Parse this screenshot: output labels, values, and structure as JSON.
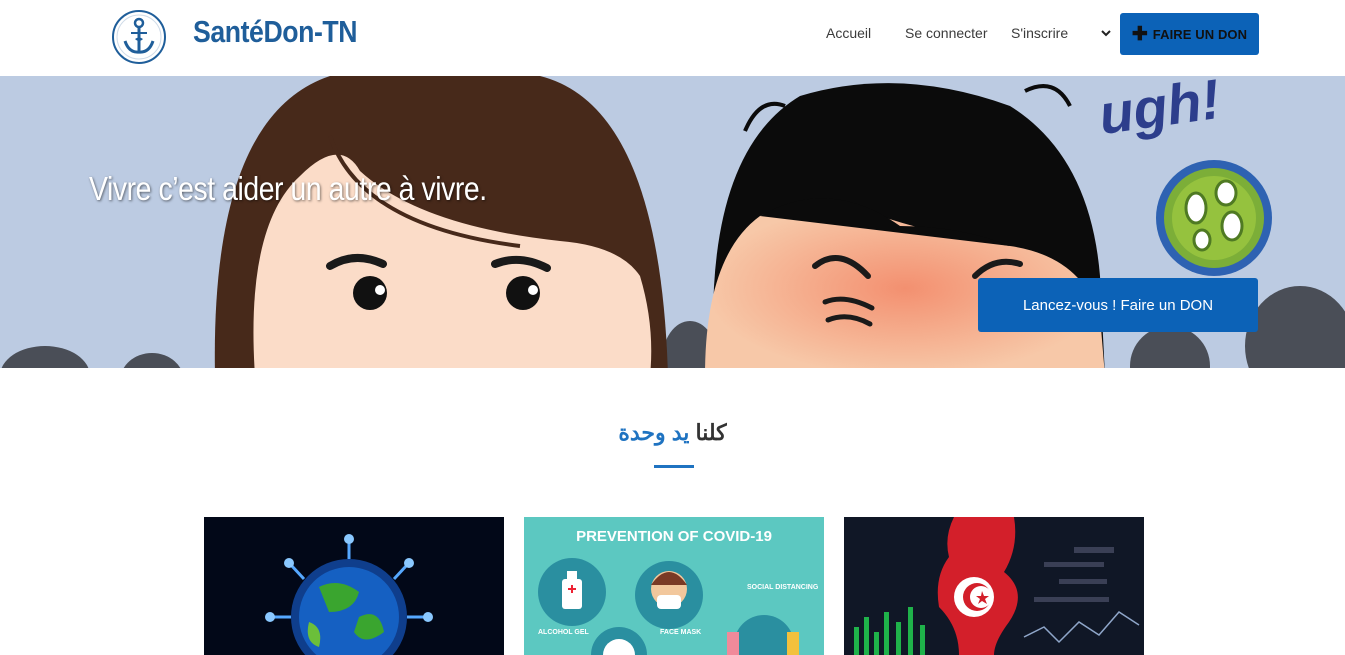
{
  "nav": {
    "brand": "SantéDon-TN",
    "links": [
      "Accueil",
      "Se connecter"
    ],
    "register_select": "S'inscrire",
    "donate_label": "FAIRE UN DON"
  },
  "hero": {
    "tagline": "Vivre c’est aider un autre à vivre.",
    "cta_label": "Lancez-vous ! Faire un DON",
    "sign_text": "ugh!"
  },
  "section": {
    "title_part1": "كلنا",
    "title_part2": "يد وحدة"
  },
  "cards": [
    {
      "name": "covid-globe",
      "text": ""
    },
    {
      "name": "prevention",
      "title": "PREVENTION OF COVID-19",
      "labels": [
        "SOCIAL DISTANCING",
        "ALCOHOL GEL",
        "FACE MASK"
      ]
    },
    {
      "name": "tunisia-map",
      "text": ""
    }
  ],
  "colors": {
    "primary": "#0c62b7",
    "brand": "#1f5e9a",
    "accent": "#1f73c1"
  }
}
